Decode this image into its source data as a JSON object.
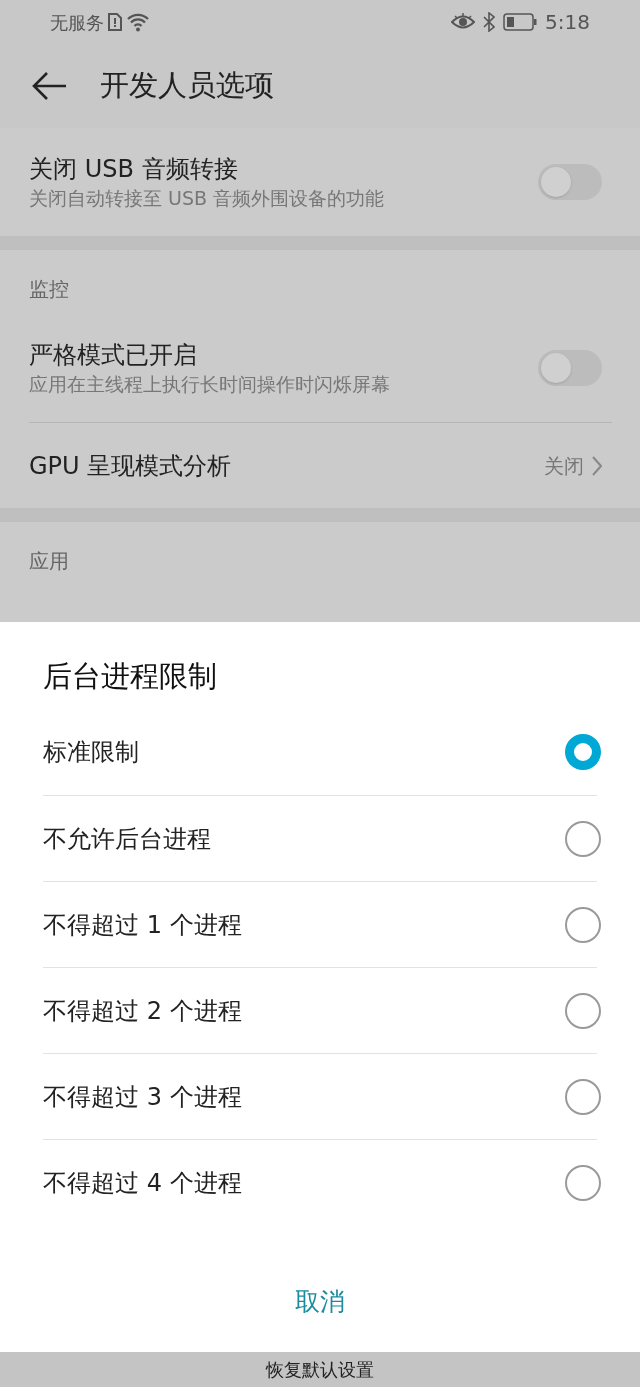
{
  "status_bar": {
    "carrier": "无服务",
    "time": "5:18"
  },
  "header": {
    "title": "开发人员选项"
  },
  "sections": [
    {
      "items": [
        {
          "kind": "toggle",
          "title": "关闭 USB 音频转接",
          "subtitle": "关闭自动转接至 USB 音频外围设备的功能",
          "on": false
        }
      ]
    },
    {
      "label": "监控",
      "items": [
        {
          "kind": "toggle",
          "title": "严格模式已开启",
          "subtitle": "应用在主线程上执行长时间操作时闪烁屏幕",
          "on": false
        },
        {
          "kind": "value",
          "title": "GPU 呈现模式分析",
          "value": "关闭"
        }
      ]
    },
    {
      "label": "应用"
    }
  ],
  "dialog": {
    "title": "后台进程限制",
    "options": [
      {
        "label": "标准限制",
        "selected": true
      },
      {
        "label": "不允许后台进程",
        "selected": false
      },
      {
        "label": "不得超过 1 个进程",
        "selected": false
      },
      {
        "label": "不得超过 2 个进程",
        "selected": false
      },
      {
        "label": "不得超过 3 个进程",
        "selected": false
      },
      {
        "label": "不得超过 4 个进程",
        "selected": false
      }
    ],
    "cancel": "取消"
  },
  "bottom_bar": "恢复默认设置"
}
